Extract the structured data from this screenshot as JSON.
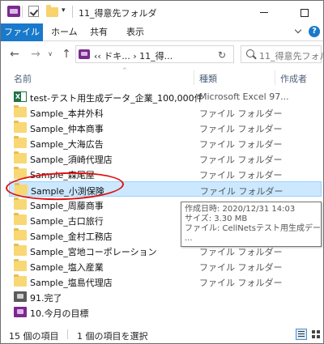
{
  "window": {
    "title": "11_得意先フォルダ",
    "qa_dropdown": "▾",
    "minimize_label": "",
    "maximize_label": ""
  },
  "ribbon": {
    "tabs": [
      {
        "label": "ファイル"
      },
      {
        "label": "ホーム"
      },
      {
        "label": "共有"
      },
      {
        "label": "表示"
      }
    ],
    "help": "?"
  },
  "nav": {
    "back": "←",
    "forward": "→",
    "recent": "∨",
    "up": "↑",
    "address": "‹‹ ドキ... › 11_得...",
    "address_drop": "∨",
    "refresh": "↻",
    "search_placeholder": "11_得意先フォル"
  },
  "columns": {
    "name": "名前",
    "type": "種類",
    "author": "作成者",
    "sort_caret": "^"
  },
  "files": [
    {
      "name": "test-テスト用生成データ_企業_100,000件",
      "type": "Microsoft Excel 97...",
      "icon": "excel-icon"
    },
    {
      "name": "Sample_本井外科",
      "type": "ファイル フォルダー",
      "icon": "folder-icon"
    },
    {
      "name": "Sample_仲本商事",
      "type": "ファイル フォルダー",
      "icon": "folder-icon"
    },
    {
      "name": "Sample_大海広告",
      "type": "ファイル フォルダー",
      "icon": "folder-icon"
    },
    {
      "name": "Sample_須崎代理店",
      "type": "ファイル フォルダー",
      "icon": "folder-icon"
    },
    {
      "name": "Sample_森尾屋",
      "type": "ファイル フォルダー",
      "icon": "folder-icon"
    },
    {
      "name": "Sample_小渕保険",
      "type": "ファイル フォルダー",
      "icon": "folder-icon",
      "selected": true
    },
    {
      "name": "Sample_周藤商事",
      "type": "ファイル フォルダー",
      "icon": "folder-icon"
    },
    {
      "name": "Sample_古口旅行",
      "type": "ファイル フォルダー",
      "icon": "folder-icon"
    },
    {
      "name": "Sample_金村工務店",
      "type": "ファイル フォルダー",
      "icon": "folder-icon"
    },
    {
      "name": "Sample_宮地コーポレーション",
      "type": "ファイル フォルダー",
      "icon": "folder-icon"
    },
    {
      "name": "Sample_塩入産業",
      "type": "ファイル フォルダー",
      "icon": "folder-icon"
    },
    {
      "name": "Sample_塩島代理店",
      "type": "ファイル フォルダー",
      "icon": "folder-icon"
    },
    {
      "name": "91.完了",
      "type": "",
      "icon": "gray-folder-icon"
    },
    {
      "name": "10.今月の目標",
      "type": "",
      "icon": "purple-folder-icon"
    }
  ],
  "tooltip": {
    "created": "作成日時: 2020/12/31 14:03",
    "size": "サイズ: 3.30 MB",
    "files": "ファイル: CellNetsテスト用生成データ_企業_...",
    "more": "..."
  },
  "status": {
    "count": "15 個の項目",
    "selected": "1 個の項目を選択"
  },
  "colors": {
    "accent": "#1979ca",
    "selection": "#cce8ff",
    "annotation": "#e01010"
  }
}
